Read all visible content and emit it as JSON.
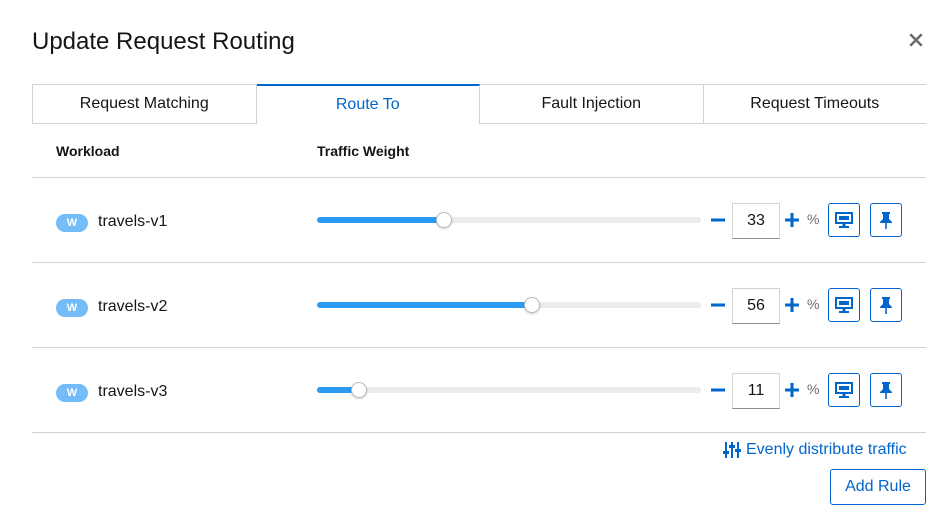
{
  "dialog": {
    "title": "Update Request Routing"
  },
  "tabs": [
    {
      "label": "Request Matching",
      "active": false
    },
    {
      "label": "Route To",
      "active": true
    },
    {
      "label": "Fault Injection",
      "active": false
    },
    {
      "label": "Request Timeouts",
      "active": false
    }
  ],
  "table": {
    "headers": {
      "workload": "Workload",
      "traffic_weight": "Traffic Weight"
    },
    "rows": [
      {
        "badge": "W",
        "name": "travels-v1",
        "weight": "33",
        "unit": "%"
      },
      {
        "badge": "W",
        "name": "travels-v2",
        "weight": "56",
        "unit": "%"
      },
      {
        "badge": "W",
        "name": "travels-v3",
        "weight": "11",
        "unit": "%"
      }
    ]
  },
  "actions": {
    "evenly_label": "Evenly distribute traffic",
    "add_rule_label": "Add Rule"
  },
  "colors": {
    "accent": "#0066cc",
    "slider_fill": "#2b9af3",
    "badge_bg": "#73bcf7",
    "border": "#d2d2d2"
  },
  "icons": {
    "close": "close-icon",
    "minus": "minus-icon",
    "plus": "plus-icon",
    "mirror": "mirror-icon",
    "pin": "pin-icon",
    "evenly": "sliders-icon"
  }
}
